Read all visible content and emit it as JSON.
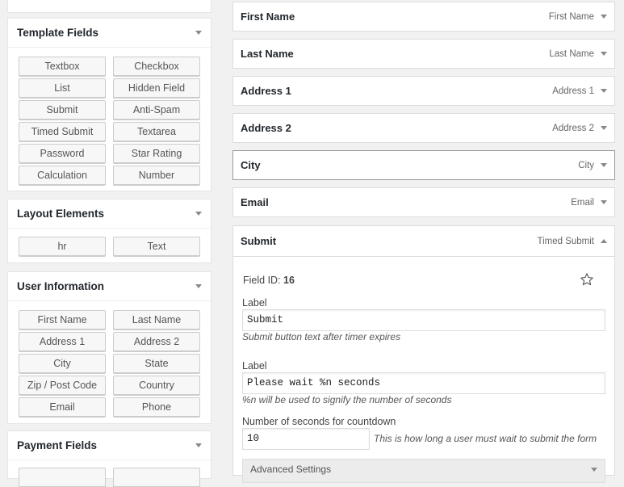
{
  "template_fields": {
    "title": "Template Fields",
    "buttons": [
      "Textbox",
      "Checkbox",
      "List",
      "Hidden Field",
      "Submit",
      "Anti-Spam",
      "Timed Submit",
      "Textarea",
      "Password",
      "Star Rating",
      "Calculation",
      "Number"
    ]
  },
  "layout_elements": {
    "title": "Layout Elements",
    "buttons": [
      "hr",
      "Text"
    ]
  },
  "user_information": {
    "title": "User Information",
    "buttons": [
      "First Name",
      "Last Name",
      "Address 1",
      "Address 2",
      "City",
      "State",
      "Zip / Post Code",
      "Country",
      "Email",
      "Phone"
    ]
  },
  "payment_fields": {
    "title": "Payment Fields"
  },
  "form_fields": [
    {
      "name": "First Name",
      "type": "First Name"
    },
    {
      "name": "Last Name",
      "type": "Last Name"
    },
    {
      "name": "Address 1",
      "type": "Address 1"
    },
    {
      "name": "Address 2",
      "type": "Address 2"
    },
    {
      "name": "City",
      "type": "City"
    },
    {
      "name": "Email",
      "type": "Email"
    }
  ],
  "submit_panel": {
    "name": "Submit",
    "type": "Timed Submit",
    "field_id_label": "Field ID:",
    "field_id": "16",
    "label1": "Label",
    "value1": "Submit",
    "help1": "Submit button text after timer expires",
    "label2": "Label",
    "value2": "Please wait %n seconds",
    "help2": "%n will be used to signify the number of seconds",
    "countdown_label": "Number of seconds for countdown",
    "countdown_value": "10",
    "countdown_help": "This is how long a user must wait to submit the form",
    "advanced": "Advanced Settings"
  }
}
